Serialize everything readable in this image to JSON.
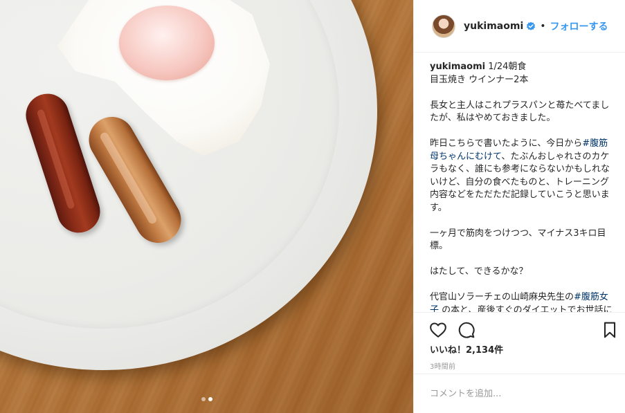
{
  "post": {
    "username": "yukimaomi",
    "verified_icon": "verified-badge-icon",
    "separator": "•",
    "follow_label": "フォローする",
    "caption_user": "yukimaomi",
    "caption_text": " 1/24朝食\n目玉焼き ウインナー2本\n\n長女と主人はこれプラスパンと苺たべてましたが、私はやめておきました。\n\n昨日こちらで書いたように、今日から",
    "hashtag_1": "#腹筋母ちゃんにむけて",
    "caption_text_2": "、たぶんおしゃれさのカケラもなく、誰にも参考にならないかもしれないけど、自分の食べたものと、トレーニング内容などをただただ記録していこうと思います。\n\n一ヶ月で筋肉をつけつつ、マイナス3キロ目標。\n\nはたして、できるかな？\n\n代官山ソラーチェの山崎麻央先生の",
    "hashtag_2": "#腹筋女子",
    "caption_text_3": " の本と、産後すぐのダイエットでお世話になったトレーナーさんの教えを参考に",
    "likes_label": "いいね！2,134件",
    "time_label": "3時間前",
    "comment_placeholder": "コメントを追加...",
    "icons": [
      "heart-icon",
      "comment-icon",
      "bookmark-icon"
    ],
    "accent_color": "#3897f0",
    "carousel": {
      "count": 2,
      "active": 2
    }
  }
}
